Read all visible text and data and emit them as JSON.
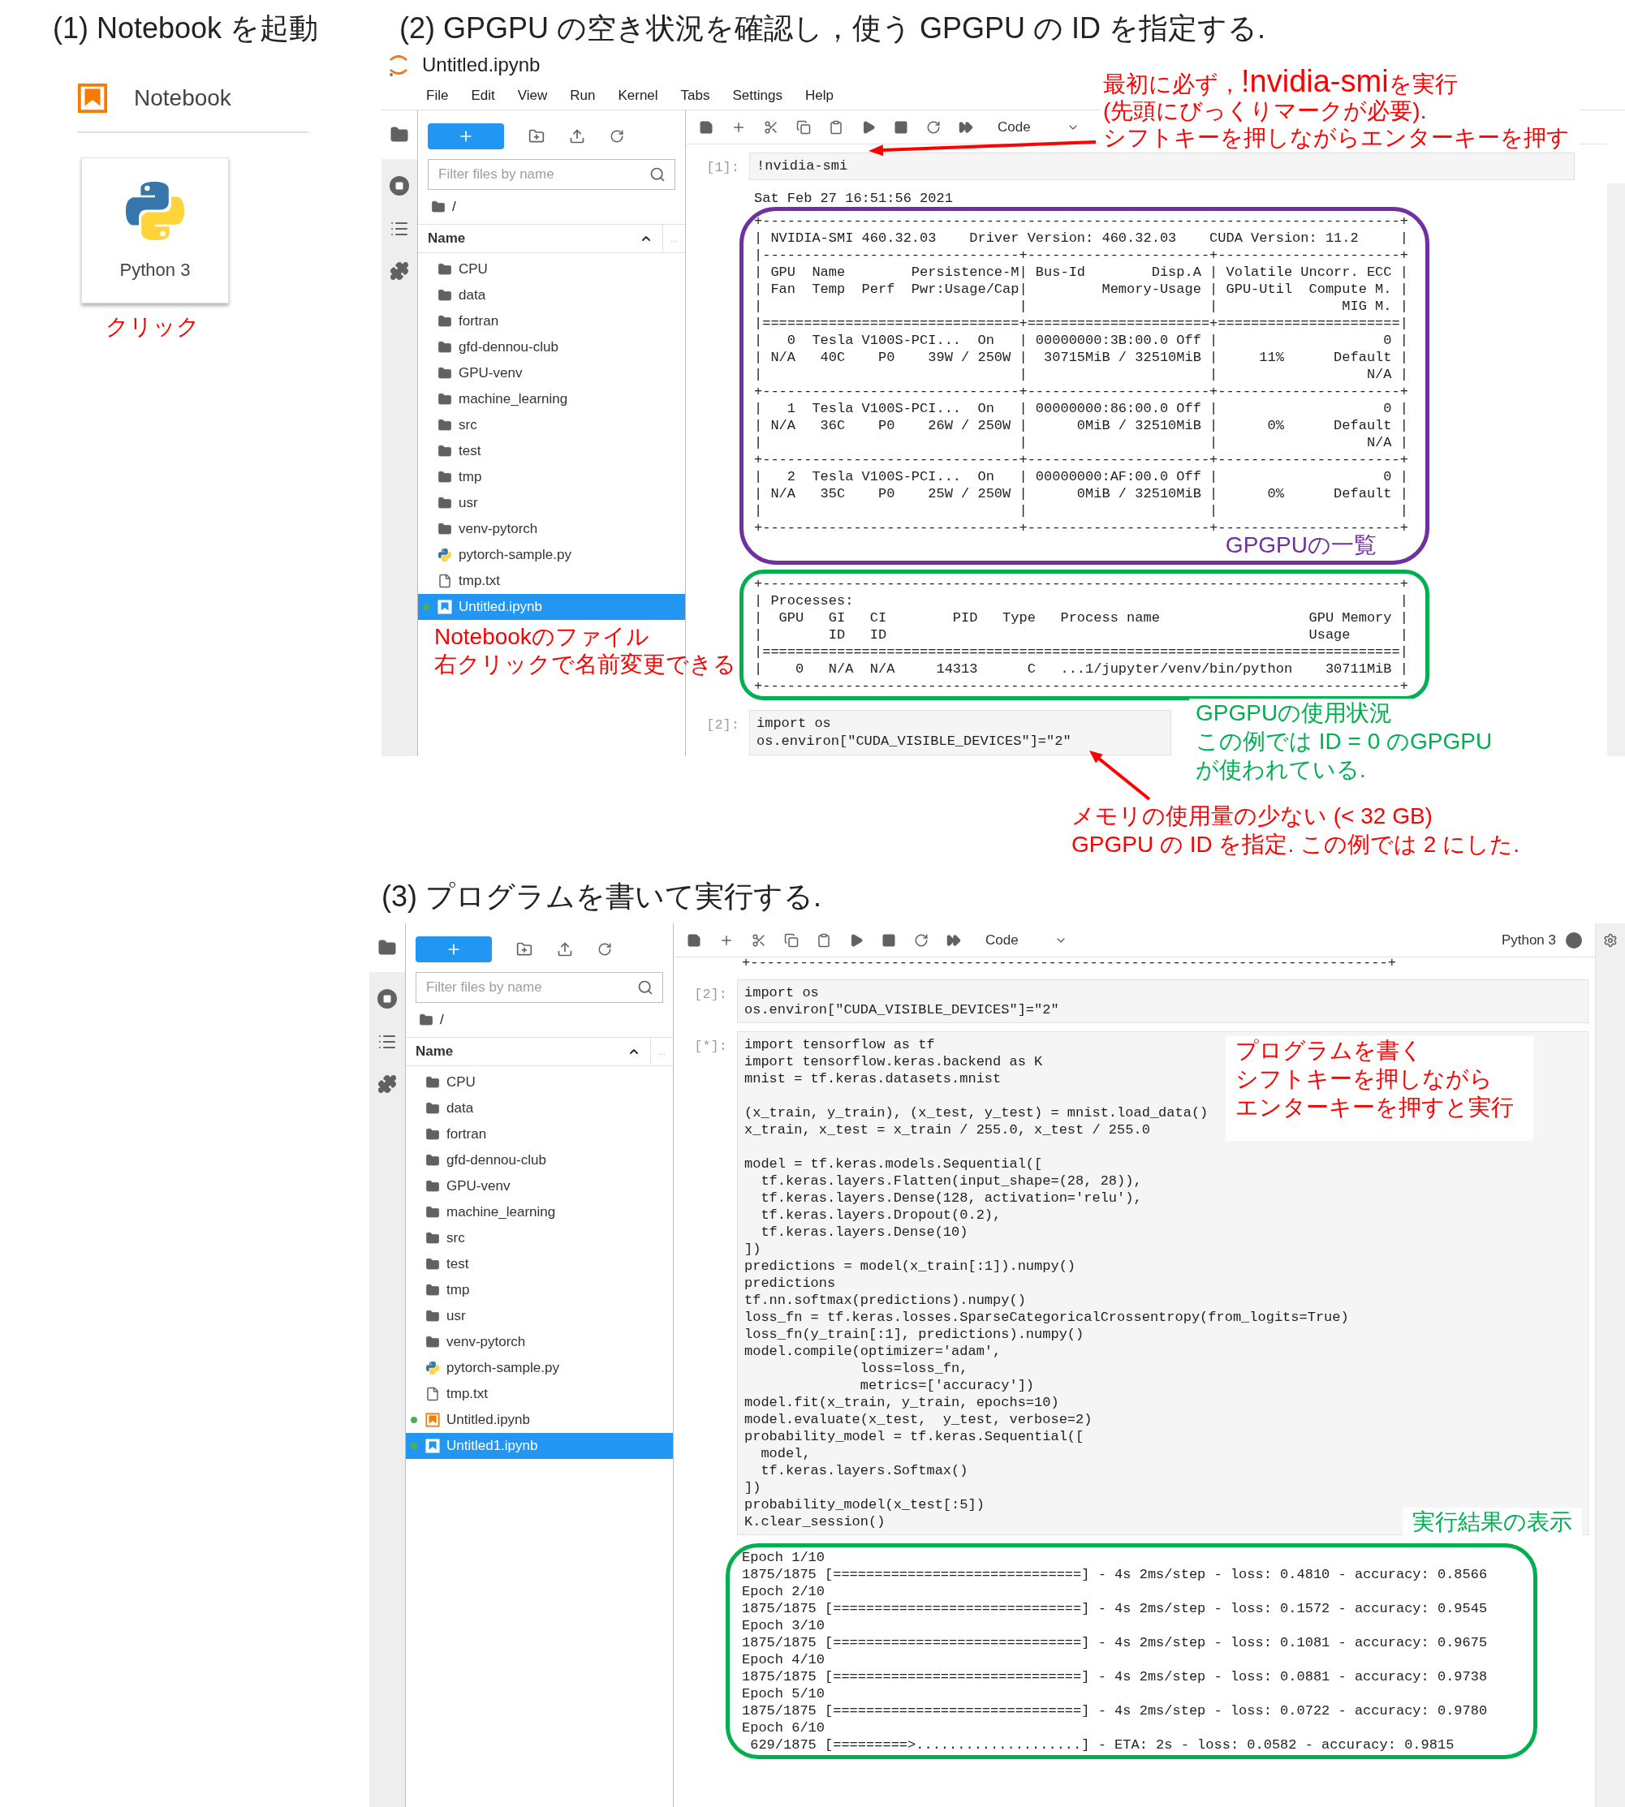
{
  "step1": {
    "heading": "(1) Notebook を起動",
    "launcher_section": "Notebook",
    "kernel_card": "Python 3",
    "note": "クリック"
  },
  "step2": {
    "heading": "(2) GPGPU の空き状況を確認し，使う GPGPU の ID を指定する.",
    "title": "Untitled.ipynb",
    "menu": [
      "File",
      "Edit",
      "View",
      "Run",
      "Kernel",
      "Tabs",
      "Settings",
      "Help"
    ],
    "browser": {
      "placeholder": "Filter files by name",
      "path": "/",
      "column": "Name",
      "column_more": "...",
      "files": [
        {
          "name": "CPU",
          "kind": "folder",
          "running": false,
          "selected": false
        },
        {
          "name": "data",
          "kind": "folder",
          "running": false,
          "selected": false
        },
        {
          "name": "fortran",
          "kind": "folder",
          "running": false,
          "selected": false
        },
        {
          "name": "gfd-dennou-club",
          "kind": "folder",
          "running": false,
          "selected": false
        },
        {
          "name": "GPU-venv",
          "kind": "folder",
          "running": false,
          "selected": false
        },
        {
          "name": "machine_learning",
          "kind": "folder",
          "running": false,
          "selected": false
        },
        {
          "name": "src",
          "kind": "folder",
          "running": false,
          "selected": false
        },
        {
          "name": "test",
          "kind": "folder",
          "running": false,
          "selected": false
        },
        {
          "name": "tmp",
          "kind": "folder",
          "running": false,
          "selected": false
        },
        {
          "name": "usr",
          "kind": "folder",
          "running": false,
          "selected": false
        },
        {
          "name": "venv-pytorch",
          "kind": "folder",
          "running": false,
          "selected": false
        },
        {
          "name": "pytorch-sample.py",
          "kind": "python",
          "running": false,
          "selected": false
        },
        {
          "name": "tmp.txt",
          "kind": "text",
          "running": false,
          "selected": false
        },
        {
          "name": "Untitled.ipynb",
          "kind": "notebook",
          "running": true,
          "selected": true
        }
      ]
    },
    "toolbar": {
      "cell_type": "Code"
    },
    "cell1": {
      "prompt": "[1]:",
      "code": [
        "!nvidia-smi"
      ]
    },
    "smi_output": {
      "date": "Sat Feb 27 16:51:56 2021",
      "gpu_table": [
        "+-----------------------------------------------------------------------------+",
        "| NVIDIA-SMI 460.32.03    Driver Version: 460.32.03    CUDA Version: 11.2     |",
        "|-------------------------------+----------------------+----------------------+",
        "| GPU  Name        Persistence-M| Bus-Id        Disp.A | Volatile Uncorr. ECC |",
        "| Fan  Temp  Perf  Pwr:Usage/Cap|         Memory-Usage | GPU-Util  Compute M. |",
        "|                               |                      |               MIG M. |",
        "|===============================+======================+======================|",
        "|   0  Tesla V100S-PCI...  On   | 00000000:3B:00.0 Off |                    0 |",
        "| N/A   40C    P0    39W / 250W |  30715MiB / 32510MiB |     11%      Default |",
        "|                               |                      |                  N/A |",
        "+-------------------------------+----------------------+----------------------+",
        "|   1  Tesla V100S-PCI...  On   | 00000000:86:00.0 Off |                    0 |",
        "| N/A   36C    P0    26W / 250W |      0MiB / 32510MiB |      0%      Default |",
        "|                               |                      |                  N/A |",
        "+-------------------------------+----------------------+----------------------+",
        "|   2  Tesla V100S-PCI...  On   | 00000000:AF:00.0 Off |                    0 |",
        "| N/A   35C    P0    25W / 250W |      0MiB / 32510MiB |      0%      Default |",
        "|                               |                      |                      |",
        "+-------------------------------+----------------------+----------------------+"
      ],
      "gpu_label": "GPGPUの一覧",
      "processes": [
        "+-----------------------------------------------------------------------------+",
        "| Processes:                                                                  |",
        "|  GPU   GI   CI        PID   Type   Process name                  GPU Memory |",
        "|        ID   ID                                                   Usage      |",
        "|=============================================================================|",
        "|    0   N/A  N/A     14313      C   ...1/jupyter/venv/bin/python    30711MiB |",
        "+-----------------------------------------------------------------------------+"
      ]
    },
    "cell2": {
      "prompt": "[2]:",
      "code": [
        "import os",
        "os.environ[\"CUDA_VISIBLE_DEVICES\"]=\"2\""
      ]
    },
    "note_run_first": {
      "before": "最初に必ず，",
      "command": "!nvidia-smi",
      "after": "を実行",
      "lines": [
        "(先頭にびっくりマークが必要).",
        "シフトキーを押しながらエンターキーを押す"
      ]
    },
    "note_file": [
      "Notebookのファイル",
      "右クリックで名前変更できる"
    ],
    "note_usage": [
      "GPGPUの使用状況",
      "この例では ID = 0 のGPGPU",
      "が使われている."
    ],
    "note_choose": [
      "メモリの使用量の少ない (< 32 GB)",
      "GPGPU の ID を指定. この例では 2 にした."
    ]
  },
  "step3": {
    "heading": "(3) プログラムを書いて実行する.",
    "browser": {
      "placeholder": "Filter files by name",
      "path": "/",
      "column": "Name",
      "column_more": "...",
      "files": [
        {
          "name": "CPU",
          "kind": "folder",
          "running": false,
          "selected": false
        },
        {
          "name": "data",
          "kind": "folder",
          "running": false,
          "selected": false
        },
        {
          "name": "fortran",
          "kind": "folder",
          "running": false,
          "selected": false
        },
        {
          "name": "gfd-dennou-club",
          "kind": "folder",
          "running": false,
          "selected": false
        },
        {
          "name": "GPU-venv",
          "kind": "folder",
          "running": false,
          "selected": false
        },
        {
          "name": "machine_learning",
          "kind": "folder",
          "running": false,
          "selected": false
        },
        {
          "name": "src",
          "kind": "folder",
          "running": false,
          "selected": false
        },
        {
          "name": "test",
          "kind": "folder",
          "running": false,
          "selected": false
        },
        {
          "name": "tmp",
          "kind": "folder",
          "running": false,
          "selected": false
        },
        {
          "name": "usr",
          "kind": "folder",
          "running": false,
          "selected": false
        },
        {
          "name": "venv-pytorch",
          "kind": "folder",
          "running": false,
          "selected": false
        },
        {
          "name": "pytorch-sample.py",
          "kind": "python",
          "running": false,
          "selected": false
        },
        {
          "name": "tmp.txt",
          "kind": "text",
          "running": false,
          "selected": false
        },
        {
          "name": "Untitled.ipynb",
          "kind": "notebook",
          "running": true,
          "selected": false
        },
        {
          "name": "Untitled1.ipynb",
          "kind": "notebook",
          "running": true,
          "selected": true
        }
      ]
    },
    "toolbar": {
      "cell_type": "Code"
    },
    "kernel": {
      "name": "Python 3",
      "busy": true
    },
    "scrolled_output": "+-----------------------------------------------------------------------------+",
    "cell2": {
      "prompt": "[2]:",
      "code": [
        "import os",
        "os.environ[\"CUDA_VISIBLE_DEVICES\"]=\"2\""
      ]
    },
    "cell3": {
      "prompt": "[*]:",
      "blocks": [
        [
          "import tensorflow as tf",
          "import tensorflow.keras.backend as K",
          "mnist = tf.keras.datasets.mnist"
        ],
        [
          "(x_train, y_train), (x_test, y_test) = mnist.load_data()",
          "x_train, x_test = x_train / 255.0, x_test / 255.0"
        ],
        [
          "model = tf.keras.models.Sequential([",
          "  tf.keras.layers.Flatten(input_shape=(28, 28)),",
          "  tf.keras.layers.Dense(128, activation='relu'),",
          "  tf.keras.layers.Dropout(0.2),",
          "  tf.keras.layers.Dense(10)",
          "])",
          "predictions = model(x_train[:1]).numpy()",
          "predictions",
          "tf.nn.softmax(predictions).numpy()",
          "loss_fn = tf.keras.losses.SparseCategoricalCrossentropy(from_logits=True)",
          "loss_fn(y_train[:1], predictions).numpy()",
          "model.compile(optimizer='adam',",
          "              loss=loss_fn,",
          "              metrics=['accuracy'])",
          "model.fit(x_train, y_train, epochs=10)",
          "model.evaluate(x_test,  y_test, verbose=2)",
          "probability_model = tf.keras.Sequential([",
          "  model,",
          "  tf.keras.layers.Softmax()",
          "])",
          "probability_model(x_test[:5])",
          "K.clear_session()"
        ]
      ]
    },
    "output": [
      "Epoch 1/10",
      "1875/1875 [==============================] - 4s 2ms/step - loss: 0.4810 - accuracy: 0.8566",
      "Epoch 2/10",
      "1875/1875 [==============================] - 4s 2ms/step - loss: 0.1572 - accuracy: 0.9545",
      "Epoch 3/10",
      "1875/1875 [==============================] - 4s 2ms/step - loss: 0.1081 - accuracy: 0.9675",
      "Epoch 4/10",
      "1875/1875 [==============================] - 4s 2ms/step - loss: 0.0881 - accuracy: 0.9738",
      "Epoch 5/10",
      "1875/1875 [==============================] - 4s 2ms/step - loss: 0.0722 - accuracy: 0.9780",
      "Epoch 6/10",
      " 629/1875 [=========>....................] - ETA: 2s - loss: 0.0582 - accuracy: 0.9815"
    ],
    "note_write": [
      "プログラムを書く",
      "シフトキーを押しながら",
      "エンターキーを押すと実行"
    ],
    "note_result": "実行結果の表示"
  }
}
